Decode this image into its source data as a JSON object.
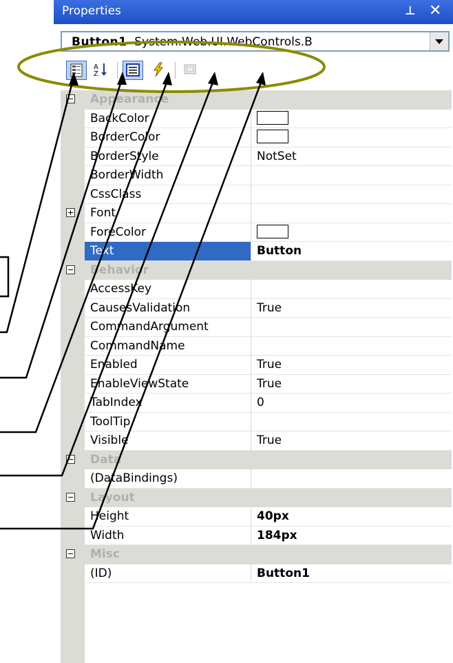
{
  "window": {
    "title": "Properties",
    "pin_glyph": "ᵖ",
    "close_glyph": "✕"
  },
  "selector": {
    "object_name": "Button1",
    "object_type": "System.Web.UI.WebControls.B"
  },
  "toolbar": {
    "buttons": [
      {
        "name": "categorized-icon",
        "active": true
      },
      {
        "name": "alphabetical-icon",
        "active": false
      },
      {
        "name": "properties-icon",
        "active": true
      },
      {
        "name": "events-icon",
        "active": false
      },
      {
        "name": "property-pages-icon",
        "active": false
      }
    ]
  },
  "grid": {
    "rows": [
      {
        "kind": "category",
        "label": "Appearance",
        "expander": "minus"
      },
      {
        "kind": "prop",
        "name": "BackColor",
        "swatch": true
      },
      {
        "kind": "prop",
        "name": "BorderColor",
        "swatch": true
      },
      {
        "kind": "prop",
        "name": "BorderStyle",
        "value": "NotSet"
      },
      {
        "kind": "prop",
        "name": "BorderWidth",
        "value": ""
      },
      {
        "kind": "prop",
        "name": "CssClass",
        "value": ""
      },
      {
        "kind": "prop",
        "name": "Font",
        "value": "",
        "expander": "plus"
      },
      {
        "kind": "prop",
        "name": "ForeColor",
        "swatch": true
      },
      {
        "kind": "prop",
        "name": "Text",
        "value": "Button",
        "bold": true,
        "selected": true
      },
      {
        "kind": "category",
        "label": "Behavior",
        "expander": "minus"
      },
      {
        "kind": "prop",
        "name": "AccessKey",
        "value": ""
      },
      {
        "kind": "prop",
        "name": "CausesValidation",
        "value": "True"
      },
      {
        "kind": "prop",
        "name": "CommandArgument",
        "value": ""
      },
      {
        "kind": "prop",
        "name": "CommandName",
        "value": ""
      },
      {
        "kind": "prop",
        "name": "Enabled",
        "value": "True"
      },
      {
        "kind": "prop",
        "name": "EnableViewState",
        "value": "True"
      },
      {
        "kind": "prop",
        "name": "TabIndex",
        "value": "0"
      },
      {
        "kind": "prop",
        "name": "ToolTip",
        "value": ""
      },
      {
        "kind": "prop",
        "name": "Visible",
        "value": "True"
      },
      {
        "kind": "category",
        "label": "Data",
        "expander": "minus"
      },
      {
        "kind": "prop",
        "name": "(DataBindings)",
        "value": ""
      },
      {
        "kind": "category",
        "label": "Layout",
        "expander": "minus"
      },
      {
        "kind": "prop",
        "name": "Height",
        "value": "40px",
        "bold": true
      },
      {
        "kind": "prop",
        "name": "Width",
        "value": "184px",
        "bold": true
      },
      {
        "kind": "category",
        "label": "Misc",
        "expander": "minus"
      },
      {
        "kind": "prop",
        "name": "(ID)",
        "value": "Button1",
        "bold": true
      }
    ]
  },
  "colors": {
    "titlebar": "#2556d6",
    "selection": "#316ac5",
    "gutter": "#dcdcd7",
    "annotation_ellipse": "#8b8b00"
  }
}
